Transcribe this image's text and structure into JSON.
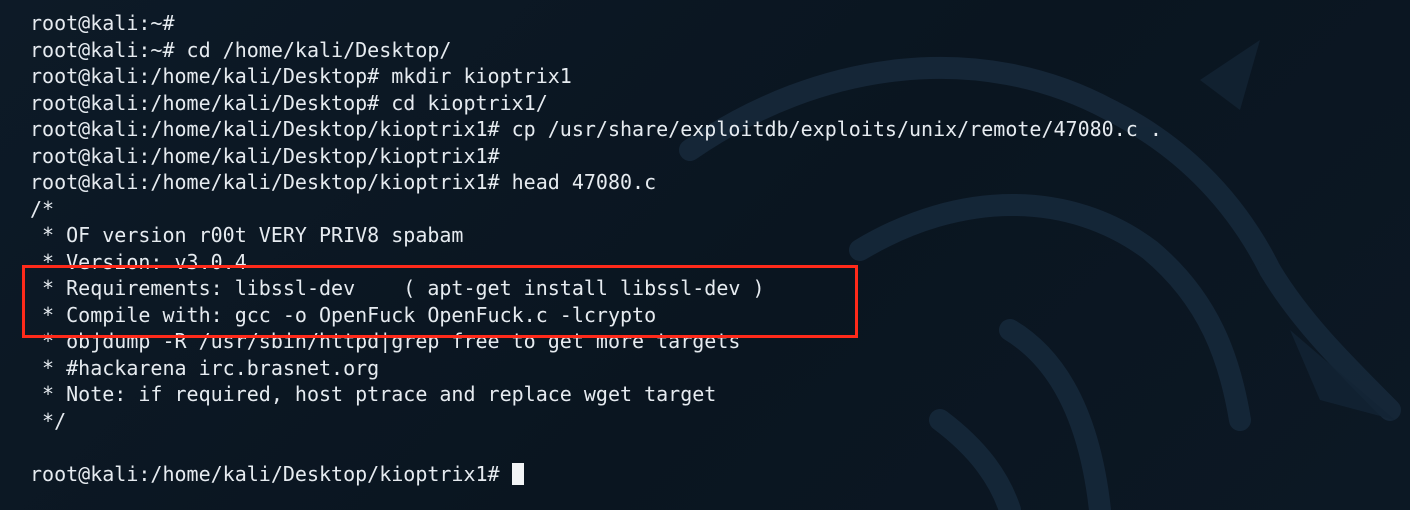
{
  "terminal": {
    "lines": [
      "root@kali:~#",
      "root@kali:~# cd /home/kali/Desktop/",
      "root@kali:/home/kali/Desktop# mkdir kioptrix1",
      "root@kali:/home/kali/Desktop# cd kioptrix1/",
      "root@kali:/home/kali/Desktop/kioptrix1# cp /usr/share/exploitdb/exploits/unix/remote/47080.c .",
      "root@kali:/home/kali/Desktop/kioptrix1#",
      "root@kali:/home/kali/Desktop/kioptrix1# head 47080.c",
      "/*",
      " * OF version r00t VERY PRIV8 spabam",
      " * Version: v3.0.4",
      " * Requirements: libssl-dev    ( apt-get install libssl-dev )",
      " * Compile with: gcc -o OpenFuck OpenFuck.c -lcrypto",
      " * objdump -R /usr/sbin/httpd|grep free to get more targets",
      " * #hackarena irc.brasnet.org",
      " * Note: if required, host ptrace and replace wget target",
      " */",
      "",
      "root@kali:/home/kali/Desktop/kioptrix1# "
    ]
  },
  "colors": {
    "background": "#0b1622",
    "text": "#e6ebf0",
    "highlight_border": "#ff2a1a"
  },
  "icons": {
    "background_watermark": "kali-dragon-icon"
  }
}
